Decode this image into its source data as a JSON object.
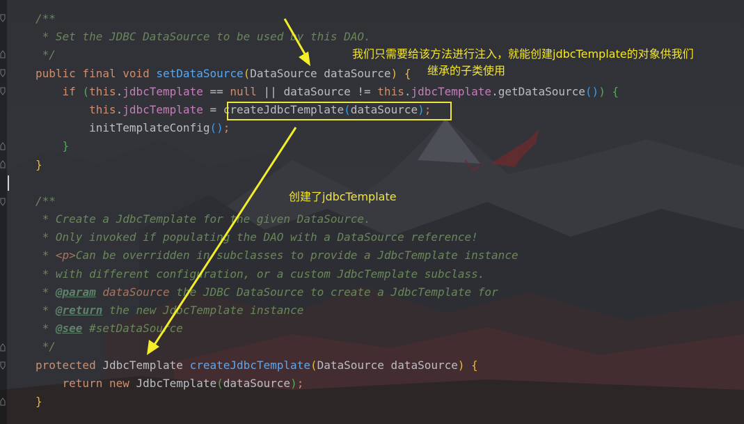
{
  "editor": {
    "lines": [
      [
        {
          "t": "/**",
          "c": "cm"
        }
      ],
      [
        {
          "t": " * Set the JDBC DataSource to be used by this DAO.",
          "c": "cm"
        }
      ],
      [
        {
          "t": " */",
          "c": "cm"
        }
      ],
      [
        {
          "t": "public final void ",
          "c": "kw"
        },
        {
          "t": "setDataSource",
          "c": "fn"
        },
        {
          "t": "(",
          "c": "br1"
        },
        {
          "t": "DataSource dataSource",
          "c": ""
        },
        {
          "t": ")",
          "c": "br1"
        },
        {
          "t": " ",
          "c": ""
        },
        {
          "t": "{",
          "c": "br1"
        }
      ],
      [
        {
          "t": "    ",
          "c": ""
        },
        {
          "t": "if ",
          "c": "kw"
        },
        {
          "t": "(",
          "c": "br2"
        },
        {
          "t": "this",
          "c": "kw"
        },
        {
          "t": ".",
          "c": ""
        },
        {
          "t": "jdbcTemplate",
          "c": "fld"
        },
        {
          "t": " == ",
          "c": ""
        },
        {
          "t": "null",
          "c": "kw"
        },
        {
          "t": " || dataSource != ",
          "c": ""
        },
        {
          "t": "this",
          "c": "kw"
        },
        {
          "t": ".",
          "c": ""
        },
        {
          "t": "jdbcTemplate",
          "c": "fld"
        },
        {
          "t": ".getDataSource",
          "c": ""
        },
        {
          "t": "()",
          "c": "br3"
        },
        {
          "t": ")",
          "c": "br2"
        },
        {
          "t": " ",
          "c": ""
        },
        {
          "t": "{",
          "c": "br2"
        }
      ],
      [
        {
          "t": "        ",
          "c": ""
        },
        {
          "t": "this",
          "c": "kw"
        },
        {
          "t": ".",
          "c": ""
        },
        {
          "t": "jdbcTemplate",
          "c": "fld"
        },
        {
          "t": " = createJdbcTemplate",
          "c": ""
        },
        {
          "t": "(",
          "c": "br3"
        },
        {
          "t": "dataSource",
          "c": ""
        },
        {
          "t": ")",
          "c": "br3"
        },
        {
          "t": ";",
          "c": "kw"
        }
      ],
      [
        {
          "t": "        initTemplateConfig",
          "c": ""
        },
        {
          "t": "()",
          "c": "br3"
        },
        {
          "t": ";",
          "c": "kw"
        }
      ],
      [
        {
          "t": "    ",
          "c": ""
        },
        {
          "t": "}",
          "c": "br2"
        }
      ],
      [
        {
          "t": "}",
          "c": "br1"
        }
      ],
      [],
      [
        {
          "t": "/**",
          "c": "cm"
        }
      ],
      [
        {
          "t": " * Create a JdbcTemplate for the given DataSource.",
          "c": "cm"
        }
      ],
      [
        {
          "t": " * Only invoked if populating the DAO with a DataSource reference!",
          "c": "cm"
        }
      ],
      [
        {
          "t": " * ",
          "c": "cm"
        },
        {
          "t": "<p>",
          "c": "prm"
        },
        {
          "t": "Can be overridden in subclasses to provide a JdbcTemplate instance",
          "c": "cm"
        }
      ],
      [
        {
          "t": " * with different configuration, or a custom JdbcTemplate subclass.",
          "c": "cm"
        }
      ],
      [
        {
          "t": " * ",
          "c": "cm"
        },
        {
          "t": "@param",
          "c": "tag"
        },
        {
          "t": " ",
          "c": "cm"
        },
        {
          "t": "dataSource",
          "c": "prm"
        },
        {
          "t": " the JDBC DataSource to create a JdbcTemplate for",
          "c": "cm"
        }
      ],
      [
        {
          "t": " * ",
          "c": "cm"
        },
        {
          "t": "@return",
          "c": "tag"
        },
        {
          "t": " the new JdbcTemplate instance",
          "c": "cm"
        }
      ],
      [
        {
          "t": " * ",
          "c": "cm"
        },
        {
          "t": "@see",
          "c": "tag"
        },
        {
          "t": " #setDataSource",
          "c": "cm"
        }
      ],
      [
        {
          "t": " */",
          "c": "cm"
        }
      ],
      [
        {
          "t": "protected ",
          "c": "kw"
        },
        {
          "t": "JdbcTemplate ",
          "c": ""
        },
        {
          "t": "createJdbcTemplate",
          "c": "fn"
        },
        {
          "t": "(",
          "c": "br1"
        },
        {
          "t": "DataSource dataSource",
          "c": ""
        },
        {
          "t": ")",
          "c": "br1"
        },
        {
          "t": " ",
          "c": ""
        },
        {
          "t": "{",
          "c": "br1"
        }
      ],
      [
        {
          "t": "    ",
          "c": ""
        },
        {
          "t": "return new ",
          "c": "kw"
        },
        {
          "t": "JdbcTemplate",
          "c": ""
        },
        {
          "t": "(",
          "c": "br2"
        },
        {
          "t": "dataSource",
          "c": ""
        },
        {
          "t": ")",
          "c": "br2"
        },
        {
          "t": ";",
          "c": "kw"
        }
      ],
      [
        {
          "t": "}",
          "c": "br1"
        }
      ]
    ]
  },
  "annotations": {
    "injection_note_line1": "我们只需要给该方法进行注入，就能创建jdbcTemplate的对象供我们",
    "injection_note_line2": "继承的子类使用",
    "created_note": "创建了jdbcTemplate"
  },
  "colors": {
    "annotation": "#f5e62f",
    "arrow": "#f4ee2a",
    "highlight_box": "#f0e53a"
  }
}
